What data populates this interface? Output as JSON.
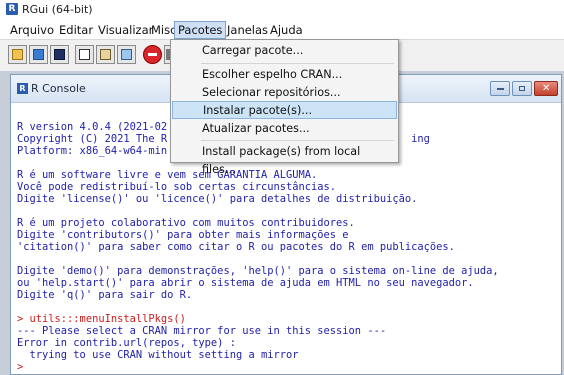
{
  "window": {
    "title": "RGui (64-bit)",
    "icon": "r-logo-icon"
  },
  "menubar": {
    "items": [
      {
        "label": "Arquivo"
      },
      {
        "label": "Editar"
      },
      {
        "label": "Visualizar"
      },
      {
        "label": "Misc"
      },
      {
        "label": "Pacotes",
        "active": true
      },
      {
        "label": "Janelas"
      },
      {
        "label": "Ajuda"
      }
    ]
  },
  "toolbar": {
    "buttons": [
      "open-script-icon",
      "load-workspace-icon",
      "save-icon",
      "copy-icon",
      "paste-icon",
      "copy-paste-icon",
      "stop-icon",
      "print-icon"
    ]
  },
  "dropdown": {
    "items": [
      {
        "label": "Carregar pacote..."
      },
      {
        "label": "Escolher espelho CRAN..."
      },
      {
        "label": "Selecionar repositórios..."
      },
      {
        "label": "Instalar pacote(s)...",
        "highlighted": true
      },
      {
        "label": "Atualizar pacotes..."
      },
      {
        "label": "Install package(s) from local files..."
      }
    ]
  },
  "console": {
    "title": "R Console",
    "lines": [
      {
        "text": "R version 4.0.4 (2021-02",
        "type": "output"
      },
      {
        "text": "Copyright (C) 2021 The R                                       ing",
        "type": "output"
      },
      {
        "text": "Platform: x86_64-w64-min",
        "type": "output"
      },
      {
        "text": "",
        "type": "output"
      },
      {
        "text": "R é um software livre e vem sem GARANTIA ALGUMA.",
        "type": "output"
      },
      {
        "text": "Você pode redistribuí-lo sob certas circunstâncias.",
        "type": "output"
      },
      {
        "text": "Digite 'license()' ou 'licence()' para detalhes de distribuição.",
        "type": "output"
      },
      {
        "text": "",
        "type": "output"
      },
      {
        "text": "R é um projeto colaborativo com muitos contribuidores.",
        "type": "output"
      },
      {
        "text": "Digite 'contributors()' para obter mais informações e",
        "type": "output"
      },
      {
        "text": "'citation()' para saber como citar o R ou pacotes do R em publicações.",
        "type": "output"
      },
      {
        "text": "",
        "type": "output"
      },
      {
        "text": "Digite 'demo()' para demonstrações, 'help()' para o sistema on-line de ajuda,",
        "type": "output"
      },
      {
        "text": "ou 'help.start()' para abrir o sistema de ajuda em HTML no seu navegador.",
        "type": "output"
      },
      {
        "text": "Digite 'q()' para sair do R.",
        "type": "output"
      },
      {
        "text": "",
        "type": "output"
      },
      {
        "text": "> utils:::menuInstallPkgs()",
        "type": "command"
      },
      {
        "text": "--- Please select a CRAN mirror for use in this session ---",
        "type": "output"
      },
      {
        "text": "Error in contrib.url(repos, type) :",
        "type": "output"
      },
      {
        "text": "  trying to use CRAN without setting a mirror",
        "type": "output"
      },
      {
        "text": ">",
        "type": "command"
      }
    ]
  },
  "colors": {
    "output": "#1f1fa8",
    "command": "#cc1d1d",
    "menu_highlight": "#cde4f7"
  }
}
